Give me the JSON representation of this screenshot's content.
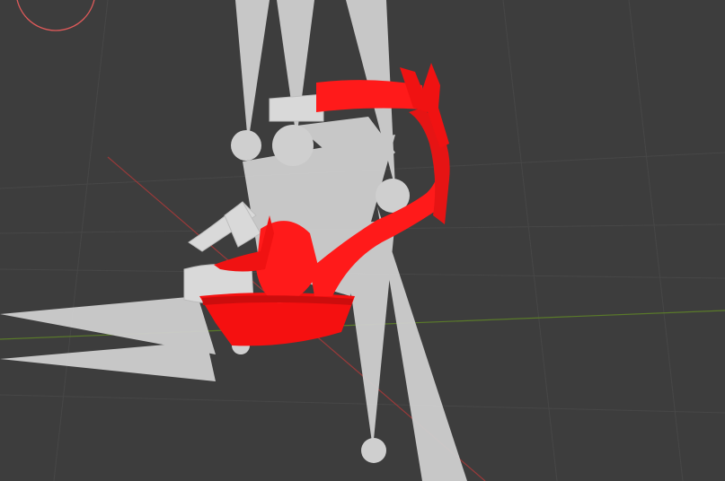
{
  "viewport": {
    "background": "#3d3d3d",
    "grid_line_color": "#474747",
    "axis_x_color": "#9a3a3a",
    "axis_y_color": "#5a7a2a",
    "light_ray_color": "#d0d0d0",
    "light_gizmo_color": "#c8c8c8",
    "model_color": "#ff1a1a",
    "model_shadow_color": "#cc0d0d",
    "ghost_model_color": "#d9d9d9",
    "cursor_color": "#e05a5a"
  },
  "objects": {
    "lights": [
      "spot-light",
      "spot-light",
      "spot-light",
      "spot-light",
      "spot-light"
    ],
    "model": "red-high-heel-sandal",
    "ghost": "gray-sandal-copy"
  }
}
